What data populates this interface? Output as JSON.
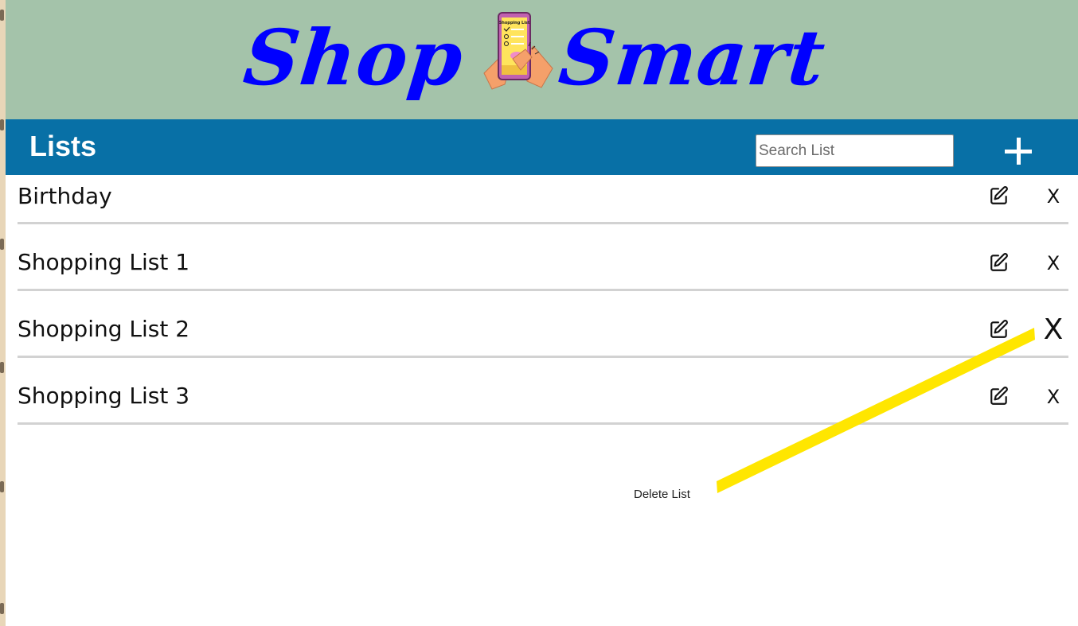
{
  "header": {
    "logo_word_1": "Shop",
    "logo_word_2": "Smart",
    "logo_phone_text": "Shopping List",
    "logo_color": "#0000ff",
    "background_color": "#a4c3aa"
  },
  "toolbar": {
    "title": "Lists",
    "search_placeholder": "Search List",
    "add_icon": "plus-icon",
    "background_color": "#0870a6"
  },
  "lists": [
    {
      "name": "Birthday",
      "edit_icon": "edit-icon",
      "delete_label": "X"
    },
    {
      "name": "Shopping List 1",
      "edit_icon": "edit-icon",
      "delete_label": "X"
    },
    {
      "name": "Shopping List 2",
      "edit_icon": "edit-icon",
      "delete_label": "X"
    },
    {
      "name": "Shopping List 3",
      "edit_icon": "edit-icon",
      "delete_label": "X"
    }
  ],
  "annotation": {
    "label": "Delete List",
    "highlight_color": "#ffe600"
  }
}
